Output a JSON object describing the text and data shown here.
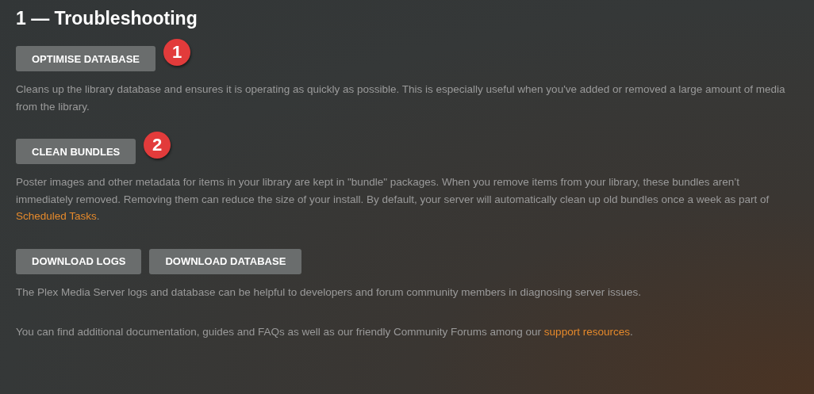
{
  "title": "1 — Troubleshooting",
  "sections": [
    {
      "buttons": [
        "OPTIMISE DATABASE"
      ],
      "marker": "1",
      "description": [
        {
          "kind": "text",
          "text": "Cleans up the library database and ensures it is operating as quickly as possible. This is especially useful when you've added or removed a large amount of media from the library."
        }
      ]
    },
    {
      "buttons": [
        "CLEAN BUNDLES"
      ],
      "marker": "2",
      "description": [
        {
          "kind": "text",
          "text": "Poster images and other metadata for items in your library are kept in \"bundle\" packages. When you remove items from your library, these bundles aren’t immediately removed. Removing them can reduce the size of your install. By default, your server will automatically clean up old bundles once a week as part of "
        },
        {
          "kind": "link",
          "text": "Scheduled Tasks"
        },
        {
          "kind": "text",
          "text": "."
        }
      ]
    },
    {
      "buttons": [
        "DOWNLOAD LOGS",
        "DOWNLOAD DATABASE"
      ],
      "description": [
        {
          "kind": "text",
          "text": "The Plex Media Server logs and database can be helpful to developers and forum community members in diagnosing server issues."
        }
      ]
    }
  ],
  "footer": [
    {
      "kind": "text",
      "text": "You can find additional documentation, guides and FAQs as well as our friendly Community Forums among our "
    },
    {
      "kind": "link",
      "text": "support resources"
    },
    {
      "kind": "text",
      "text": "."
    }
  ]
}
